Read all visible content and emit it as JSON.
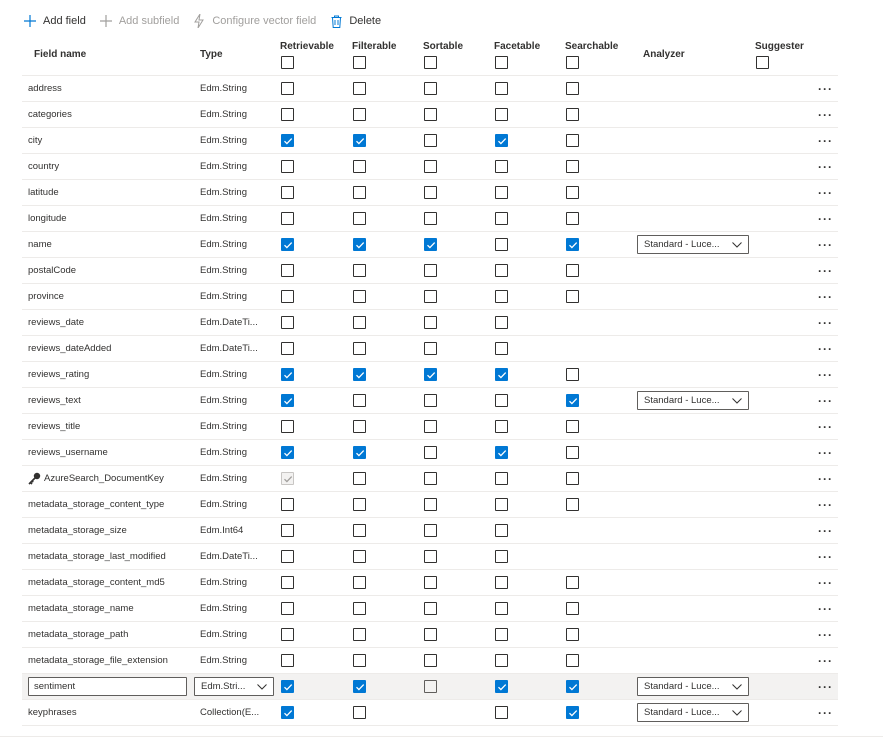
{
  "toolbar": {
    "add_field": "Add field",
    "add_subfield": "Add subfield",
    "configure_vector": "Configure vector field",
    "delete": "Delete"
  },
  "headers": {
    "field_name": "Field name",
    "type": "Type",
    "retrievable": "Retrievable",
    "filterable": "Filterable",
    "sortable": "Sortable",
    "facetable": "Facetable",
    "searchable": "Searchable",
    "analyzer": "Analyzer",
    "suggester": "Suggester"
  },
  "colors": {
    "accent": "#0078d4"
  },
  "rows": [
    {
      "name": "address",
      "type": "Edm.String",
      "r": false,
      "f": false,
      "s": false,
      "fa": false,
      "se": false,
      "analyzer": ""
    },
    {
      "name": "categories",
      "type": "Edm.String",
      "r": false,
      "f": false,
      "s": false,
      "fa": false,
      "se": false,
      "analyzer": ""
    },
    {
      "name": "city",
      "type": "Edm.String",
      "r": true,
      "f": true,
      "s": false,
      "fa": true,
      "se": false,
      "analyzer": ""
    },
    {
      "name": "country",
      "type": "Edm.String",
      "r": false,
      "f": false,
      "s": false,
      "fa": false,
      "se": false,
      "analyzer": ""
    },
    {
      "name": "latitude",
      "type": "Edm.String",
      "r": false,
      "f": false,
      "s": false,
      "fa": false,
      "se": false,
      "analyzer": ""
    },
    {
      "name": "longitude",
      "type": "Edm.String",
      "r": false,
      "f": false,
      "s": false,
      "fa": false,
      "se": false,
      "analyzer": ""
    },
    {
      "name": "name",
      "type": "Edm.String",
      "r": true,
      "f": true,
      "s": true,
      "fa": false,
      "se": true,
      "analyzer": "Standard - Luce..."
    },
    {
      "name": "postalCode",
      "type": "Edm.String",
      "r": false,
      "f": false,
      "s": false,
      "fa": false,
      "se": false,
      "analyzer": ""
    },
    {
      "name": "province",
      "type": "Edm.String",
      "r": false,
      "f": false,
      "s": false,
      "fa": false,
      "se": false,
      "analyzer": ""
    },
    {
      "name": "reviews_date",
      "type": "Edm.DateTi...",
      "r": false,
      "f": false,
      "s": false,
      "fa": false,
      "se": null,
      "analyzer": ""
    },
    {
      "name": "reviews_dateAdded",
      "type": "Edm.DateTi...",
      "r": false,
      "f": false,
      "s": false,
      "fa": false,
      "se": null,
      "analyzer": ""
    },
    {
      "name": "reviews_rating",
      "type": "Edm.String",
      "r": true,
      "f": true,
      "s": true,
      "fa": true,
      "se": false,
      "analyzer": ""
    },
    {
      "name": "reviews_text",
      "type": "Edm.String",
      "r": true,
      "f": false,
      "s": false,
      "fa": false,
      "se": true,
      "analyzer": "Standard - Luce..."
    },
    {
      "name": "reviews_title",
      "type": "Edm.String",
      "r": false,
      "f": false,
      "s": false,
      "fa": false,
      "se": false,
      "analyzer": ""
    },
    {
      "name": "reviews_username",
      "type": "Edm.String",
      "r": true,
      "f": true,
      "s": false,
      "fa": true,
      "se": false,
      "analyzer": ""
    },
    {
      "name": "AzureSearch_DocumentKey",
      "type": "Edm.String",
      "r": "disabled-on",
      "f": false,
      "s": false,
      "fa": false,
      "se": false,
      "analyzer": "",
      "key": true
    },
    {
      "name": "metadata_storage_content_type",
      "type": "Edm.String",
      "r": false,
      "f": false,
      "s": false,
      "fa": false,
      "se": false,
      "analyzer": ""
    },
    {
      "name": "metadata_storage_size",
      "type": "Edm.Int64",
      "r": false,
      "f": false,
      "s": false,
      "fa": false,
      "se": null,
      "analyzer": ""
    },
    {
      "name": "metadata_storage_last_modified",
      "type": "Edm.DateTi...",
      "r": false,
      "f": false,
      "s": false,
      "fa": false,
      "se": null,
      "analyzer": ""
    },
    {
      "name": "metadata_storage_content_md5",
      "type": "Edm.String",
      "r": false,
      "f": false,
      "s": false,
      "fa": false,
      "se": false,
      "analyzer": ""
    },
    {
      "name": "metadata_storage_name",
      "type": "Edm.String",
      "r": false,
      "f": false,
      "s": false,
      "fa": false,
      "se": false,
      "analyzer": ""
    },
    {
      "name": "metadata_storage_path",
      "type": "Edm.String",
      "r": false,
      "f": false,
      "s": false,
      "fa": false,
      "se": false,
      "analyzer": ""
    },
    {
      "name": "metadata_storage_file_extension",
      "type": "Edm.String",
      "r": false,
      "f": false,
      "s": false,
      "fa": false,
      "se": false,
      "analyzer": ""
    },
    {
      "name": "sentiment",
      "type": "Edm.Stri...",
      "r": true,
      "f": true,
      "s": "disabled",
      "fa": true,
      "se": true,
      "analyzer": "Standard - Luce...",
      "editing": true
    },
    {
      "name": "keyphrases",
      "type": "Collection(E...",
      "r": true,
      "f": false,
      "s": null,
      "fa": false,
      "se": true,
      "analyzer": "Standard - Luce..."
    }
  ]
}
